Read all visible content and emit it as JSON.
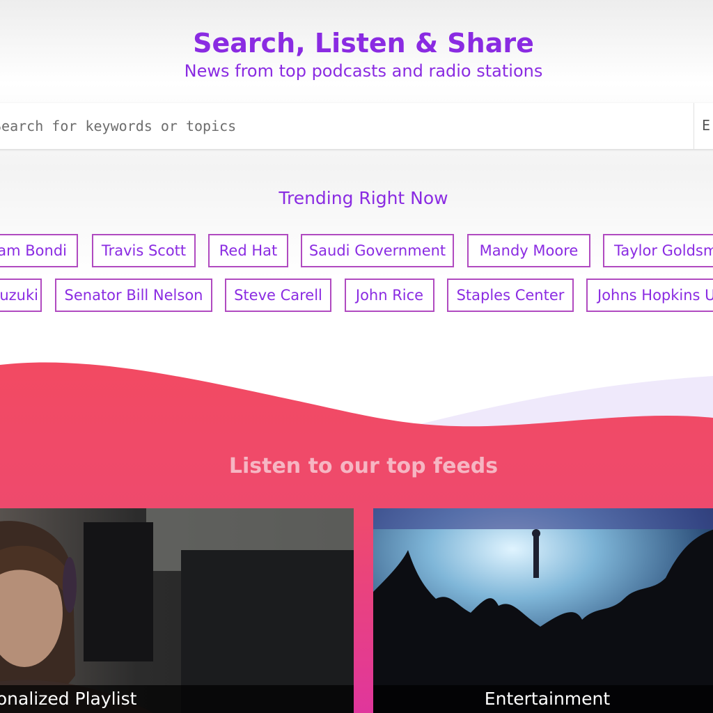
{
  "hero": {
    "title": "Search, Listen & Share",
    "subtitle": "News from top podcasts and radio stations"
  },
  "search": {
    "placeholder": "Search for keywords or topics",
    "button_label": "E"
  },
  "trending": {
    "title": "Trending Right Now",
    "row1": [
      "Pam Bondi",
      "Travis Scott",
      "Red Hat",
      "Saudi Government",
      "Mandy Moore",
      "Taylor Goldsmith"
    ],
    "row2": [
      "Suzuki",
      "Senator Bill Nelson",
      "Steve Carell",
      "John Rice",
      "Staples Center",
      "Johns Hopkins University"
    ]
  },
  "feeds": {
    "title": "Listen to our top feeds",
    "cards": [
      {
        "caption": "Personalized Playlist"
      },
      {
        "caption": "Entertainment"
      }
    ]
  },
  "colors": {
    "accent": "#8a2be2",
    "chip_border": "#b04ac0",
    "wave_top": "#f24a62",
    "wave_bottom": "#e23aa0"
  }
}
